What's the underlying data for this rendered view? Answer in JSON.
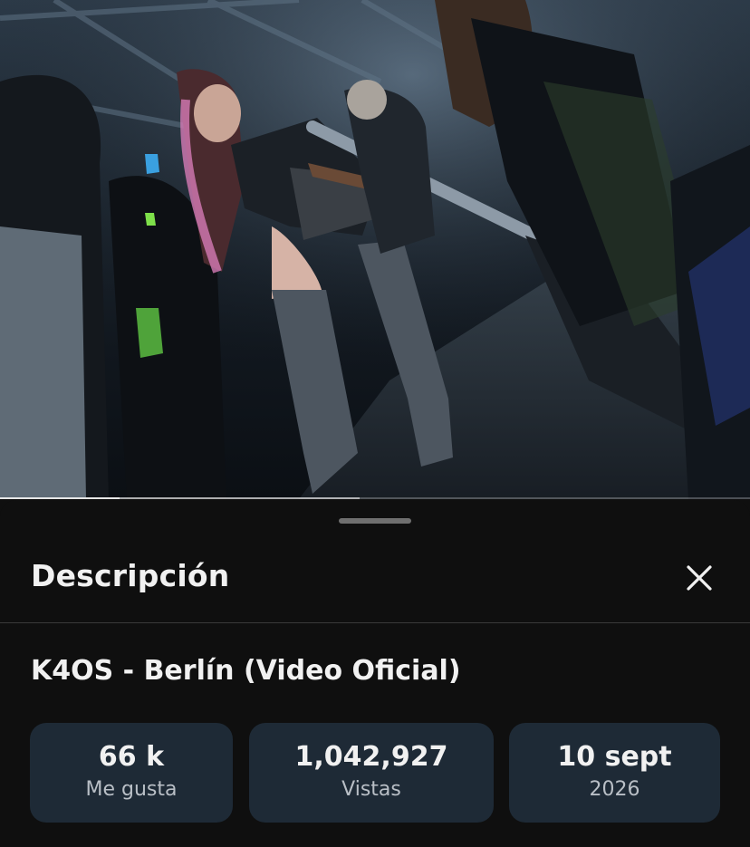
{
  "video": {
    "progress_played": 0.16,
    "progress_buffered": 0.48
  },
  "sheet": {
    "title": "Descripción",
    "close_icon": "close-icon"
  },
  "video_title": "K4OS - Berlín (Video Oficial)",
  "stats": [
    {
      "value": "66 k",
      "label": "Me gusta"
    },
    {
      "value": "1,042,927",
      "label": "Vistas"
    },
    {
      "value": "10 sept",
      "label": "2026"
    }
  ],
  "colors": {
    "background": "#0f0f0f",
    "card": "#1e2a36",
    "text": "#f1f1f1",
    "muted": "#b9bfc6"
  }
}
